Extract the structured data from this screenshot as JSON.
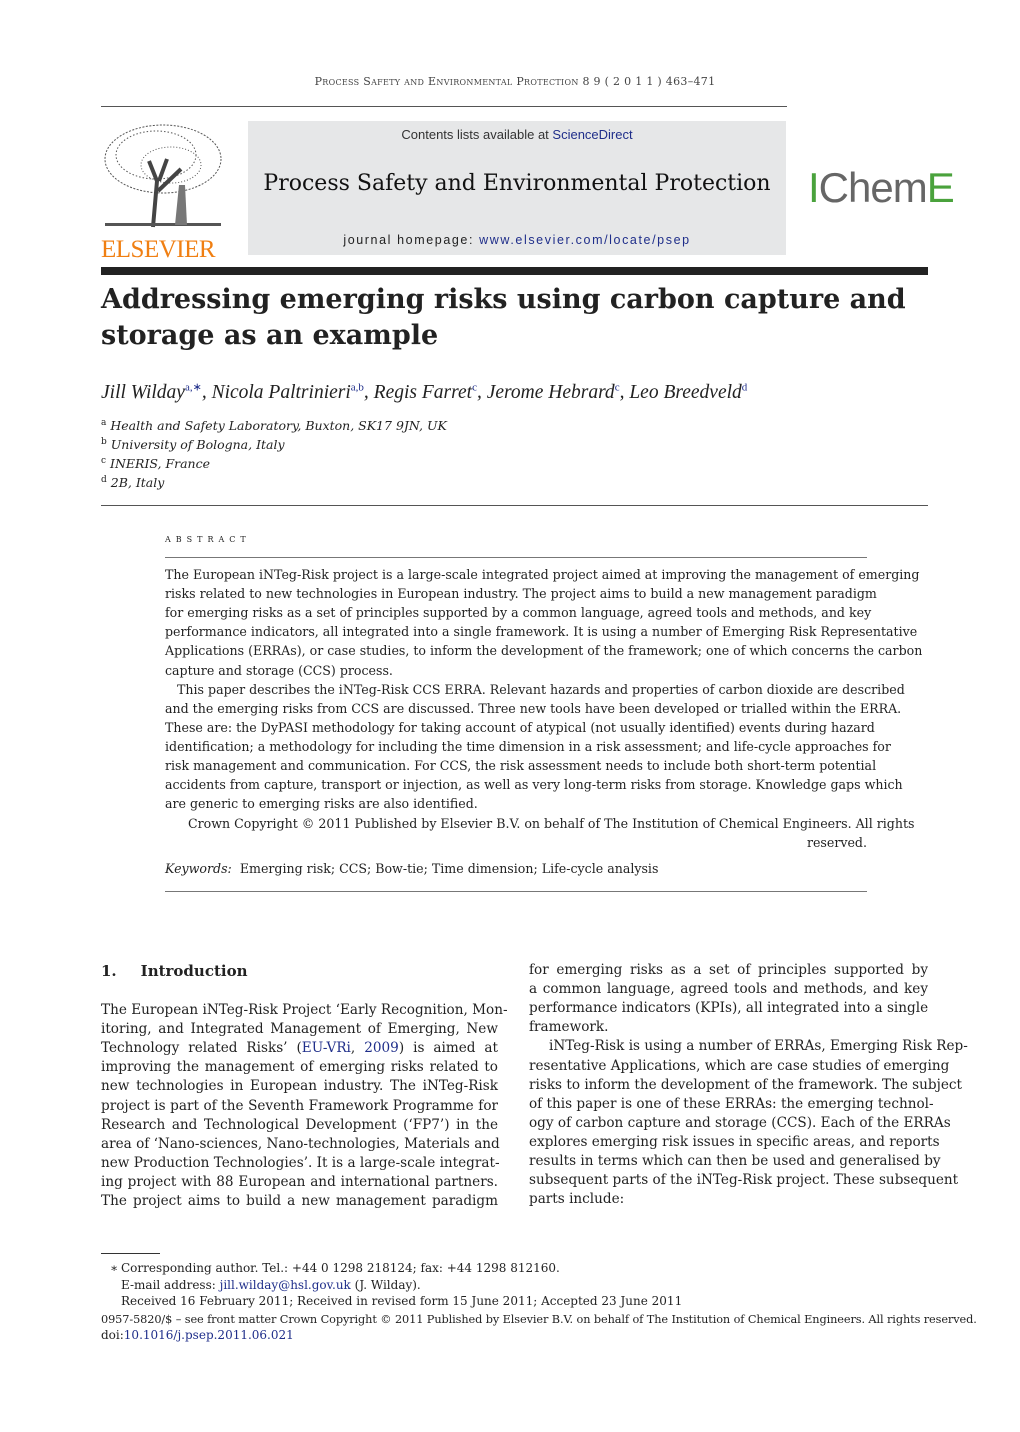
{
  "running_header": "Process Safety and Environmental Protection  8 9  ( 2 0 1 1 ) 463–471",
  "publisher_logo": "ELSEVIER",
  "banner": {
    "contents_prefix": "Contents lists available at ",
    "contents_link": "ScienceDirect",
    "journal_title": "Process Safety and Environmental Protection",
    "homepage_prefix": "journal homepage: ",
    "homepage_link": "www.elsevier.com/locate/psep"
  },
  "society_logo": {
    "text": "IChemE",
    "color": "#4aa23c"
  },
  "title": "Addressing emerging risks using carbon capture and storage as an example",
  "authors": [
    {
      "name": "Jill Wilday",
      "sup": "a,∗"
    },
    {
      "name": "Nicola Paltrinieri",
      "sup": "a,b"
    },
    {
      "name": "Regis Farret",
      "sup": "c"
    },
    {
      "name": "Jerome Hebrard",
      "sup": "c"
    },
    {
      "name": "Leo Breedveld",
      "sup": "d"
    }
  ],
  "affiliations": [
    {
      "sup": "a",
      "text": "Health and Safety Laboratory, Buxton, SK17 9JN, UK"
    },
    {
      "sup": "b",
      "text": "University of Bologna, Italy"
    },
    {
      "sup": "c",
      "text": "INERIS, France"
    },
    {
      "sup": "d",
      "text": "2B, Italy"
    }
  ],
  "abstract": {
    "heading": "abstract",
    "lines": [
      "The European iNTeg-Risk project is a large-scale integrated project aimed at improving the management of emerging",
      "risks related to new technologies in European industry. The project aims to build a new management paradigm",
      "for emerging risks as a set of principles supported by a common language, agreed tools and methods, and key",
      "performance indicators, all integrated into a single framework. It is using a number of Emerging Risk Representative",
      "Applications (ERRAs), or case studies, to inform the development of the framework; one of which concerns the carbon",
      "capture and storage (CCS) process.",
      "This paper describes the iNTeg-Risk CCS ERRA. Relevant hazards and properties of carbon dioxide are described",
      "and the emerging risks from CCS are discussed. Three new tools have been developed or trialled within the ERRA.",
      "These are: the DyPASI methodology for taking account of atypical (not usually identified) events during hazard",
      "identification; a methodology for including the time dimension in a risk assessment; and life-cycle approaches for",
      "risk management and communication. For CCS, the risk assessment needs to include both short-term potential",
      "accidents from capture, transport or injection, as well as very long-term risks from storage. Knowledge gaps which",
      "are generic to emerging risks are also identified.",
      "Crown Copyright © 2011 Published by Elsevier B.V. on behalf of The Institution of Chemical Engineers. All rights",
      "reserved."
    ],
    "keywords_label": "Keywords:",
    "keywords": "Emerging risk; CCS; Bow-tie; Time dimension; Life-cycle analysis"
  },
  "section": {
    "number": "1.",
    "title": "Introduction"
  },
  "left_column": [
    "The European iNTeg-Risk Project ‘Early Recognition, Mon-",
    "itoring, and Integrated Management of Emerging, New",
    [
      [
        "Technology related Risks’ (",
        false
      ],
      [
        "EU-VRi",
        true
      ],
      [
        ", ",
        false
      ],
      [
        "2009",
        true
      ],
      [
        ") is aimed at",
        false
      ]
    ],
    "improving the management of emerging risks related to",
    "new technologies in European industry. The iNTeg-Risk",
    "project is part of the Seventh Framework Programme for",
    "Research and Technological Development (‘FP7’) in the",
    "area of ‘Nano-sciences, Nano-technologies, Materials and",
    "new Production Technologies’. It is a large-scale integrat-",
    "ing project with 88 European and international partners.",
    "The project aims to build a new management paradigm"
  ],
  "right_column": [
    "for emerging risks as a set of principles supported by",
    "a common language, agreed tools and methods, and key",
    "performance indicators (KPIs), all integrated into a single",
    "framework.",
    "iNTeg-Risk is using a number of ERRAs, Emerging Risk Rep-",
    "resentative Applications, which are case studies of emerging",
    "risks to inform the development of the framework. The subject",
    "of this paper is one of these ERRAs: the emerging technol-",
    "ogy of carbon capture and storage (CCS). Each of the ERRAs",
    "explores emerging risk issues in specific areas, and reports",
    "results in terms which can then be used and generalised by",
    "subsequent parts of the iNTeg-Risk project. These subsequent",
    "parts include:"
  ],
  "footnotes": {
    "star": "∗",
    "corresponding": "Corresponding author. Tel.: +44 0 1298 218124; fax: +44 1298 812160.",
    "email_label": "E-mail address: ",
    "email": "jill.wilday@hsl.gov.uk",
    "email_suffix": " (J. Wilday).",
    "received": "Received 16 February 2011; Received in revised form 15 June 2011; Accepted 23 June 2011",
    "copyright": "0957-5820/$ – see front matter Crown Copyright © 2011 Published by Elsevier B.V. on behalf of The Institution of Chemical Engineers. All rights reserved.",
    "doi_label": "doi:",
    "doi": "10.1016/j.psep.2011.06.021"
  }
}
